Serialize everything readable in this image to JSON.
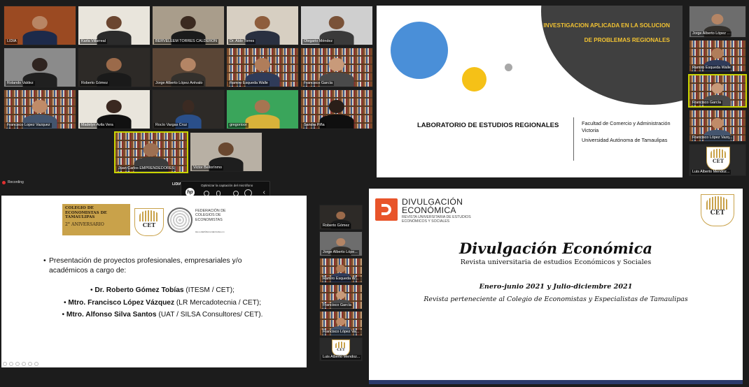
{
  "recording": {
    "label": "Recording"
  },
  "top_name": "LIDIA",
  "mic_popup": {
    "label": "Optimizar la captación del micrófono",
    "hp": "hp",
    "chevron": "‹"
  },
  "gallery_main": [
    {
      "name": "LIDIA"
    },
    {
      "name": "Karla Villarreal"
    },
    {
      "name": "BERVELEEM TORRES CALDERON"
    },
    {
      "name": "Dr. Aldo Torres"
    },
    {
      "name": "Olegario Méndez"
    },
    {
      "name": "Rolando Valdez"
    },
    {
      "name": "Roberto Gómez"
    },
    {
      "name": "Jorge Alberto López Arévalo"
    },
    {
      "name": "Ramiro Esqueda Walle"
    },
    {
      "name": "Francisco García"
    },
    {
      "name": "Francisco Lopez Vazquez"
    },
    {
      "name": "Madelyn Avila Vera"
    },
    {
      "name": "Rocío Vargas Cruz"
    },
    {
      "name": "gregorioor"
    },
    {
      "name": "Sandra Piña"
    },
    {
      "name": "Juan Carlos EMPRENDEDORES"
    },
    {
      "name": "Victor Bellorínmo"
    }
  ],
  "gallery_side_top": [
    {
      "name": "Jorge Alberto López ..."
    },
    {
      "name": "Ramiro Esqueda Walle"
    },
    {
      "name": "Francisco García"
    },
    {
      "name": "Francisco López Vazq..."
    },
    {
      "name": "Luis Alberto Mendoz..."
    }
  ],
  "gallery_side_mid": [
    {
      "name": "Roberto Gómez"
    },
    {
      "name": "Jorge Alberto Lópe..."
    },
    {
      "name": "Ramiro Esqueda Walle"
    },
    {
      "name": "Francisco García"
    },
    {
      "name": "Francisco López Vazq..."
    },
    {
      "name": "Luis Alberto Mendoz..."
    }
  ],
  "slide1": {
    "topic": "INVESTIGACION APLICADA EN LA SOLUCION DE PROBLEMAS REGIONALES",
    "lab": "LABORATORIO DE ESTUDIOS REGIONALES",
    "faculty": "Facultad de Comercio y Administración Victoria",
    "university": "Universidad Autónoma de Tamaulipas"
  },
  "slide2": {
    "logo_title": "COLEGIO DE ECONOMISTAS DE TAMAULIPAS",
    "logo_anniv": "2° ANIVERSARIO",
    "cet": "CET",
    "fed_title": "FEDERACIÓN DE COLEGIOS DE ECONOMISTAS",
    "fed_sub": "DE LA REPÚBLICA MEXICANA A.C.",
    "intro": "Presentación de proyectos profesionales, empresariales y/o académicos a cargo de:",
    "presenters": [
      {
        "name": "Dr. Roberto Gómez Tobías",
        "org": "(ITESM / CET);"
      },
      {
        "name": "Mtro. Francisco López Vázquez",
        "org": "(LR Mercadotecnia / CET);"
      },
      {
        "name": "Mtro. Alfonso Silva Santos",
        "org": "(UAT / SILSA Consultores/ CET)."
      }
    ]
  },
  "slide3": {
    "brand_line1": "DIVULGACIÓN",
    "brand_line2": "ECONÓMICA",
    "brand_line3": "REVISTA UNIVERSITARIA DE ESTUDIOS ECONÓMICOS Y SOCIALES",
    "cet": "CET",
    "title": "Divulgación Económica",
    "subtitle": "Revista universitaria de estudios Económicos y Sociales",
    "period": "Enero-junio 2021 y Julio-diciembre 2021",
    "belongs": "Revista perteneciente al Colegio de Economistas y Especialistas de Tamaulipas"
  }
}
